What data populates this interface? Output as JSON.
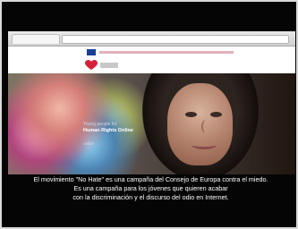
{
  "hero": {
    "kicker": "Young people for",
    "title": "Human Rights Online",
    "link": "online"
  },
  "subtitle": {
    "text": "El movimiento \"No Hate\" es una campaña del Consejo de Europa contra el miedo.\nEs una campaña para los jóvenes que quieren acabar\ncon la discriminación y el discurso del odio en Internet."
  },
  "colors": {
    "frame_bg": "#050505",
    "eu_blue": "#1d3d96",
    "logo_red": "#d81f3a"
  }
}
